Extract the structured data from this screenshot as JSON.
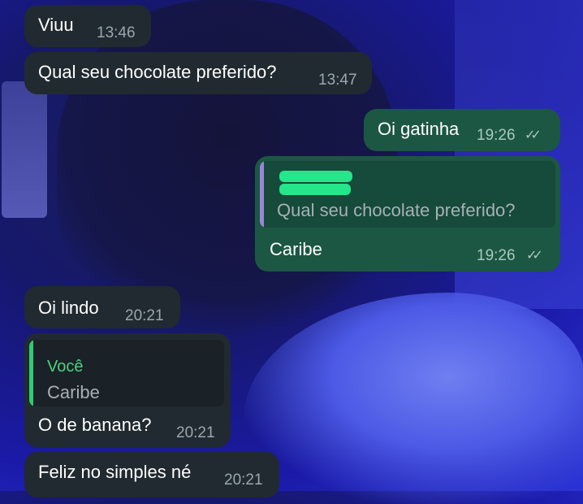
{
  "messages": [
    {
      "text": "Viuu",
      "time": "13:46"
    },
    {
      "text": "Qual seu chocolate preferido?",
      "time": "13:47"
    },
    {
      "text": "Oi gatinha",
      "time": "19:26"
    },
    {
      "text": "Caribe",
      "time": "19:26",
      "quote": {
        "text": "Qual seu chocolate preferido?"
      }
    },
    {
      "text": "Oi lindo",
      "time": "20:21"
    },
    {
      "text": "O de banana?",
      "time": "20:21",
      "quote": {
        "name": "Você",
        "text": "Caribe"
      }
    },
    {
      "text": "Feliz no simples né",
      "time": "20:21"
    }
  ],
  "colors": {
    "incoming": "#212a30",
    "outgoing": "#1c5744",
    "quote_bar_out": "#9a86d8",
    "quote_bar_in": "#2ecc71",
    "redaction": "#25e68a"
  },
  "icons": {
    "read": "double-check-icon"
  }
}
